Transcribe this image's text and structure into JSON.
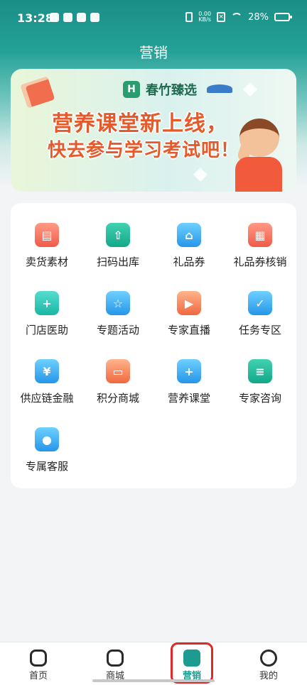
{
  "status_bar": {
    "time": "13:28",
    "net_speed_value": "0.00",
    "net_speed_unit": "KB/s",
    "battery": "28%"
  },
  "header": {
    "title": "营销"
  },
  "banner": {
    "brand": "春竹臻选",
    "headline_1": "营养课堂新上线，",
    "headline_2": "快去参与学习考试吧！"
  },
  "menu": {
    "items": [
      {
        "label": "卖货素材",
        "icon": "material-icon"
      },
      {
        "label": "扫码出库",
        "icon": "scan-out-icon"
      },
      {
        "label": "礼品券",
        "icon": "gift-voucher-icon"
      },
      {
        "label": "礼品券核销",
        "icon": "qr-verify-icon"
      },
      {
        "label": "门店医助",
        "icon": "medical-assistant-icon"
      },
      {
        "label": "专题活动",
        "icon": "topic-activity-icon"
      },
      {
        "label": "专家直播",
        "icon": "live-icon"
      },
      {
        "label": "任务专区",
        "icon": "task-icon"
      },
      {
        "label": "供应链金融",
        "icon": "finance-icon"
      },
      {
        "label": "积分商城",
        "icon": "points-shop-icon"
      },
      {
        "label": "营养课堂",
        "icon": "nutrition-class-icon"
      },
      {
        "label": "专家咨询",
        "icon": "consult-icon"
      },
      {
        "label": "专属客服",
        "icon": "customer-service-icon"
      }
    ]
  },
  "bottom_nav": {
    "tabs": [
      {
        "label": "首页",
        "icon": "home-icon"
      },
      {
        "label": "商城",
        "icon": "shop-icon"
      },
      {
        "label": "营销",
        "icon": "marketing-icon"
      },
      {
        "label": "我的",
        "icon": "profile-icon"
      }
    ],
    "active": "营销"
  }
}
